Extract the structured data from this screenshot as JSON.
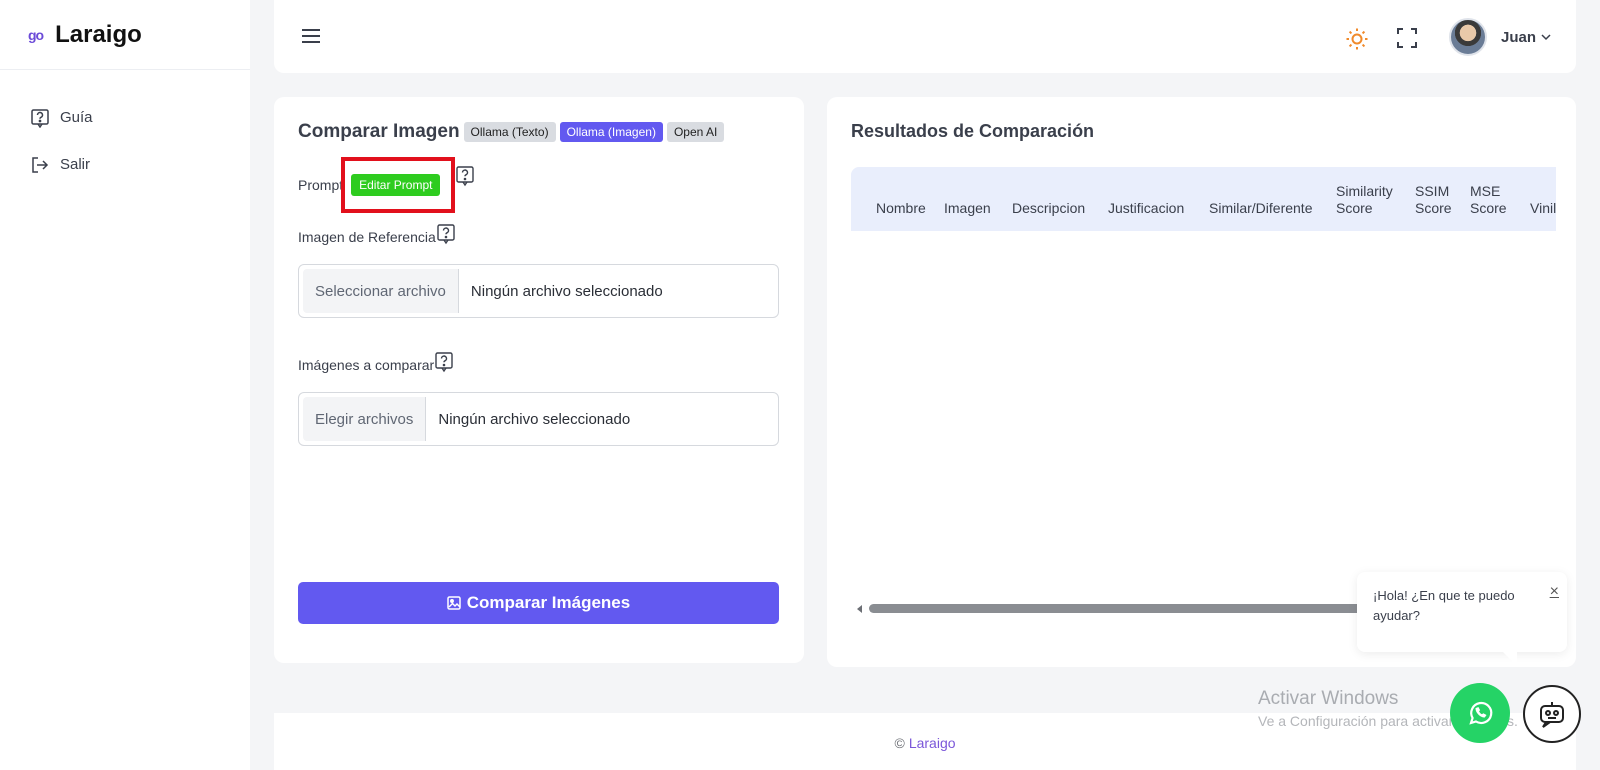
{
  "sidebar": {
    "brand_mark": "go",
    "brand_name": "Laraigo",
    "items": [
      {
        "label": "Guía",
        "icon": "help-square-icon"
      },
      {
        "label": "Salir",
        "icon": "logout-icon"
      }
    ]
  },
  "topbar": {
    "user_name": "Juan"
  },
  "left_card": {
    "title": "Comparar Imagen",
    "tabs": [
      {
        "label": "Ollama (Texto)",
        "active": false
      },
      {
        "label": "Ollama (Imagen)",
        "active": true
      },
      {
        "label": "Open AI",
        "active": false
      }
    ],
    "prompt_label": "Prompt",
    "edit_prompt": "Editar Prompt",
    "reference_label": "Imagen de Referencia",
    "reference_button": "Seleccionar archivo",
    "reference_status": "Ningún archivo seleccionado",
    "compare_label": "Imágenes a comparar",
    "compare_button": "Elegir archivos",
    "compare_status": "Ningún archivo seleccionado",
    "submit": "Comparar Imágenes"
  },
  "right_card": {
    "title": "Resultados de Comparación",
    "columns": [
      "Nombre",
      "Imagen",
      "Descripcion",
      "Justificacion",
      "Similar/Diferente",
      "Similarity Score",
      "SSIM Score",
      "MSE Score",
      "Vinil"
    ]
  },
  "footer": {
    "copyright": "©",
    "link": "Laraigo"
  },
  "chat": {
    "message": "¡Hola! ¿En que te puedo ayudar?",
    "close": "×"
  },
  "watermark": {
    "title": "Activar Windows",
    "subtitle": "Ve a Configuración para activar Windows."
  },
  "colors": {
    "accent": "#6259f0",
    "edit_green": "#2ecc1f",
    "highlight_red": "#e2101c",
    "whatsapp": "#25d366"
  }
}
